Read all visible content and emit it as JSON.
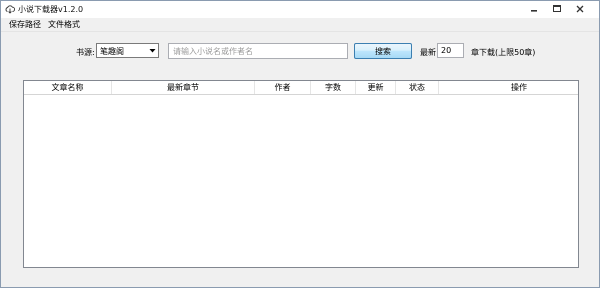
{
  "window": {
    "title": "小说下载器v1.2.0",
    "app_icon": "cloud-download-icon"
  },
  "menu": {
    "items": [
      "保存路径",
      "文件格式"
    ]
  },
  "toolbar": {
    "source_label": "书源:",
    "source_value": "笔趣阁",
    "search_placeholder": "请输入小说名或作者名",
    "search_value": "",
    "search_button": "搜索",
    "latest_label": "最新",
    "latest_count": "20",
    "unit_label": "章下载(上限50章)"
  },
  "table": {
    "columns": [
      "文章名称",
      "最新章节",
      "作者",
      "字数",
      "更新",
      "状态",
      "操作"
    ],
    "rows": []
  }
}
